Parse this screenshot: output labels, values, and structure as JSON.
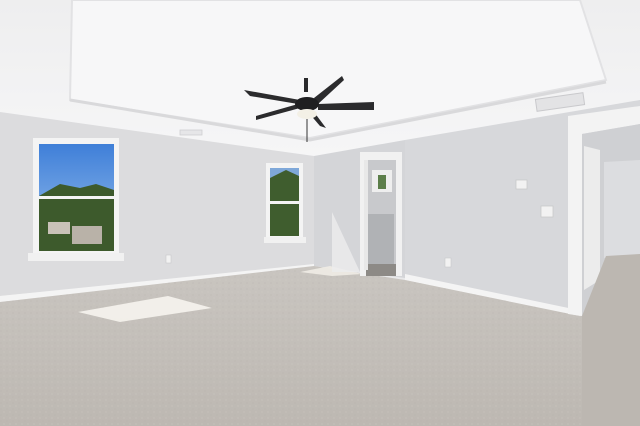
{
  "image": {
    "kind": "photograph",
    "subject": "empty-carpeted-room",
    "colors": {
      "ceiling": "#f1f1f2",
      "tray_ceiling": "#f6f6f7",
      "wall_left": "#dcdcde",
      "wall_back": "#d4d5d8",
      "wall_right": "#d9d9dc",
      "trim": "#f7f7f7",
      "carpet": "#c5c0bb",
      "carpet_shadow": "#b8b3ad",
      "sky": "#5a96e0",
      "trees": "#3d5a2c",
      "fan": "#2a2a2c",
      "sunlight": "#f4f2ec"
    }
  }
}
